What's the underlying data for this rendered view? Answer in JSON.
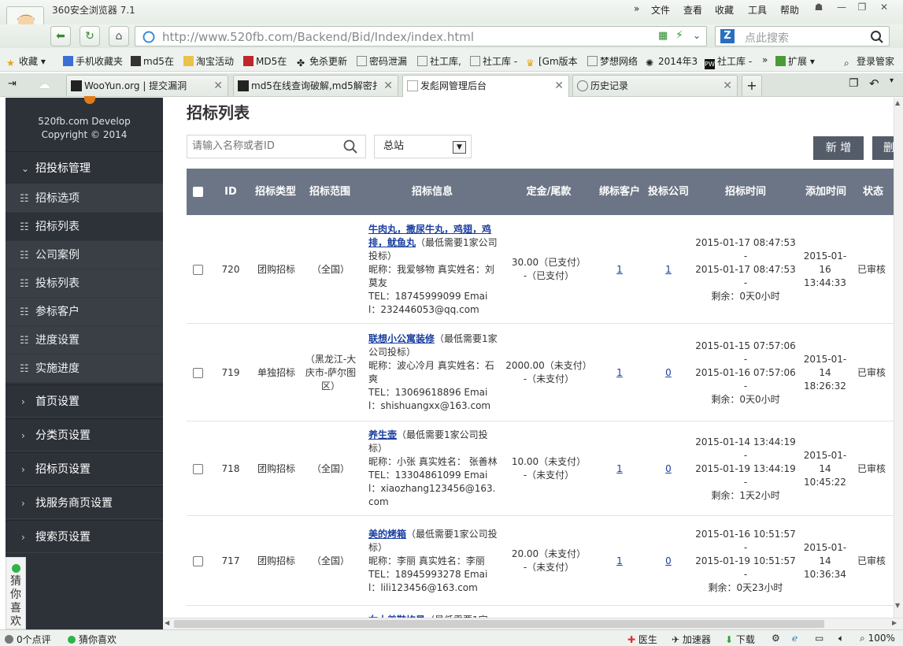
{
  "browser": {
    "title": "360安全浏览器 7.1",
    "menus": [
      "文件",
      "查看",
      "收藏",
      "工具",
      "帮助"
    ],
    "url_host": "http://www.520fb.com",
    "url_path": "/Backend/Bid/Index/index.html",
    "search_placeholder": "点此搜索",
    "bookmarks": [
      "收藏",
      "手机收藏夹",
      "md5在",
      "淘宝活动",
      "MD5在",
      "免杀更新",
      "密码泄漏",
      "社工库,",
      "社工库 -",
      "[Gm版本",
      "梦想网络",
      "2014年3",
      "社工库 -",
      "扩展",
      "登录管家"
    ],
    "tabs": [
      "WooYun.org | 提交漏洞",
      "md5在线查询破解,md5解密扌",
      "发彪网管理后台",
      "历史记录"
    ],
    "status": {
      "left1": "0个点评",
      "left2": "猜你喜欢",
      "doctor": "医生",
      "accel": "加速器",
      "download": "下载",
      "zoom": "100%"
    }
  },
  "sidebar": {
    "brand_line1": "520fb.com Develop",
    "brand_line2": "Copyright © 2014",
    "section_bid": "招投标管理",
    "sub_items": [
      "招标选项",
      "招标列表",
      "公司案例",
      "投标列表",
      "参标客户",
      "进度设置",
      "实施进度"
    ],
    "sections": [
      "首页设置",
      "分类页设置",
      "招标页设置",
      "找服务商页设置",
      "搜索页设置"
    ],
    "guess": "猜你喜欢"
  },
  "main": {
    "title": "招标列表",
    "search_placeholder": "请输入名称或者ID",
    "select_value": "总站",
    "btn_new": "新 增",
    "btn_del": "删"
  },
  "table": {
    "headers": [
      "ID",
      "招标类型",
      "招标范围",
      "招标信息",
      "定金/尾款",
      "绑标客户",
      "投标公司",
      "招标时间",
      "添加时间",
      "状态"
    ],
    "rows": [
      {
        "id": "720",
        "type": "团购招标",
        "scope": "（全国）",
        "title": "牛肉丸，撒尿牛丸，鸡翅，鸡排，鱿鱼丸",
        "min": "（最低需要1家公司投标）",
        "contact": "昵称：我爱够物 真实姓名：刘莫友",
        "tel": "TEL：18745999099 Email：232446053@qq.com",
        "money1": "30.00（已支付）",
        "money2": "-（已支付）",
        "clients": "1",
        "companies": "1",
        "t1": "2015-01-17 08:47:53",
        "t2": "2015-01-17 08:47:53",
        "remain": "剩余：0天0小时",
        "added": "2015-01-16 13:44:33",
        "status": "已审核"
      },
      {
        "id": "719",
        "type": "单独招标",
        "scope": "（黑龙江-大庆市-萨尔图区）",
        "title": "联想小公寓装修",
        "min": "（最低需要1家公司投标）",
        "contact": "昵称：波心冷月 真实姓名：石爽",
        "tel": "TEL：13069618896 Email：shishuangxx@163.com",
        "money1": "2000.00（未支付）",
        "money2": "-（未支付）",
        "clients": "1",
        "companies": "0",
        "t1": "2015-01-15 07:57:06",
        "t2": "2015-01-16 07:57:06",
        "remain": "剩余：0天0小时",
        "added": "2015-01-14 18:26:32",
        "status": "已审核"
      },
      {
        "id": "718",
        "type": "团购招标",
        "scope": "（全国）",
        "title": "养生壶",
        "min": "（最低需要1家公司投标）",
        "contact": "昵称：小张 真实姓名： 张善林",
        "tel": "TEL：13304861099 Email：xiaozhang123456@163.com",
        "money1": "10.00（未支付）",
        "money2": "-（未支付）",
        "clients": "1",
        "companies": "0",
        "t1": "2015-01-14 13:44:19",
        "t2": "2015-01-19 13:44:19",
        "remain": "剩余：1天2小时",
        "added": "2015-01-14 10:45:22",
        "status": "已审核"
      },
      {
        "id": "717",
        "type": "团购招标",
        "scope": "（全国）",
        "title": "美的烤箱",
        "min": "（最低需要1家公司投标）",
        "contact": "昵称：李丽 真实姓名：李丽",
        "tel": "TEL：18945993278 Email：lili123456@163.com",
        "money1": "20.00（未支付）",
        "money2": "-（未支付）",
        "clients": "1",
        "companies": "0",
        "t1": "2015-01-16 10:51:57",
        "t2": "2015-01-19 10:51:57",
        "remain": "剩余：0天23小时",
        "added": "2015-01-14 10:36:34",
        "status": "已审核"
      },
      {
        "id": "",
        "type": "",
        "scope": "",
        "title": "女士美鞋均是",
        "min": "（最低需要1家",
        "contact": "",
        "tel": "",
        "money1": "",
        "money2": "",
        "clients": "",
        "companies": "",
        "t1": "",
        "t2": "",
        "remain": "",
        "added": "",
        "status": ""
      }
    ]
  }
}
